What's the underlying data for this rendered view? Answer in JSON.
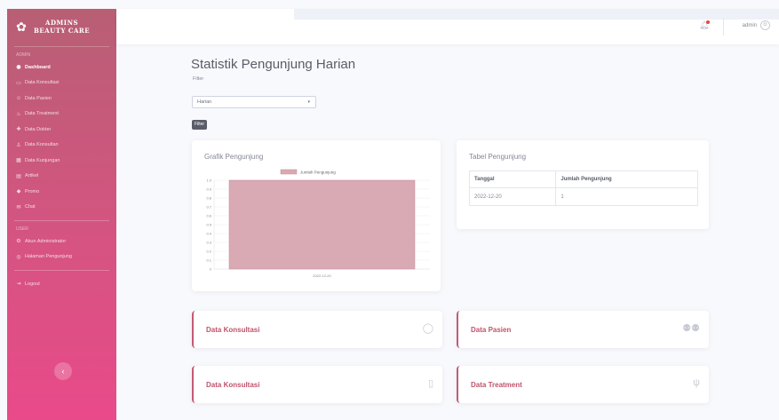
{
  "brand": {
    "line1": "ADMINS",
    "line2": "BEAUTY CARE"
  },
  "sidebar": {
    "heading1": "Admin",
    "items": [
      {
        "label": "Dashboard",
        "icon": "tachometer-icon",
        "active": true
      },
      {
        "label": "Data Konsultasi",
        "icon": "comment-icon"
      },
      {
        "label": "Data Pasien",
        "icon": "users-icon"
      },
      {
        "label": "Data Treatment",
        "icon": "spa-icon"
      },
      {
        "label": "Data Dokter",
        "icon": "user-md-icon"
      },
      {
        "label": "Data Konsultan",
        "icon": "user-tie-icon"
      },
      {
        "label": "Data Kunjungan",
        "icon": "calendar-icon"
      },
      {
        "label": "Artikel",
        "icon": "newspaper-icon"
      },
      {
        "label": "Promo",
        "icon": "tag-icon"
      },
      {
        "label": "Chat",
        "icon": "chat-icon"
      }
    ],
    "heading2": "User",
    "items2": [
      {
        "label": "Akun Administrator",
        "icon": "user-cog-icon"
      },
      {
        "label": "Halaman Pengunjung",
        "icon": "globe-icon"
      }
    ],
    "logout": "Logout"
  },
  "topbar": {
    "username": "admin"
  },
  "main": {
    "title": "Statistik Pengunjung Harian",
    "filter_label": "Filter",
    "filter_value": "Harian",
    "filter_button": "Filter"
  },
  "chart_card": {
    "title": "Grafik Pengunjung"
  },
  "chart_data": {
    "type": "bar",
    "categories": [
      "2022-12-20"
    ],
    "series": [
      {
        "name": "Jumlah Pengunjung",
        "values": [
          1
        ]
      }
    ],
    "ylim": [
      0,
      1
    ],
    "yticks": [
      "1.0",
      "0.9",
      "0.8",
      "0.7",
      "0.6",
      "0.5",
      "0.4",
      "0.3",
      "0.2",
      "0.1",
      "0"
    ],
    "color": "#d9aab4",
    "grid": true,
    "legend": "top"
  },
  "table_card": {
    "title": "Tabel Pengunjung",
    "headers": [
      "Tanggal",
      "Jumlah Pengunjung"
    ],
    "rows": [
      [
        "2022-12-20",
        "1"
      ]
    ]
  },
  "stats": [
    {
      "label": "Data Konsultasi",
      "icon": "comment-icon"
    },
    {
      "label": "Data Pasien",
      "icon": "users-icon"
    },
    {
      "label": "Data Konsultasi",
      "icon": "clipboard-icon"
    },
    {
      "label": "Data Treatment",
      "icon": "spa-icon"
    }
  ],
  "colors": {
    "sidebar_top": "#b85f74",
    "sidebar_bottom": "#e94a8a",
    "accent": "#c0536c",
    "bar": "#d9aab4"
  }
}
